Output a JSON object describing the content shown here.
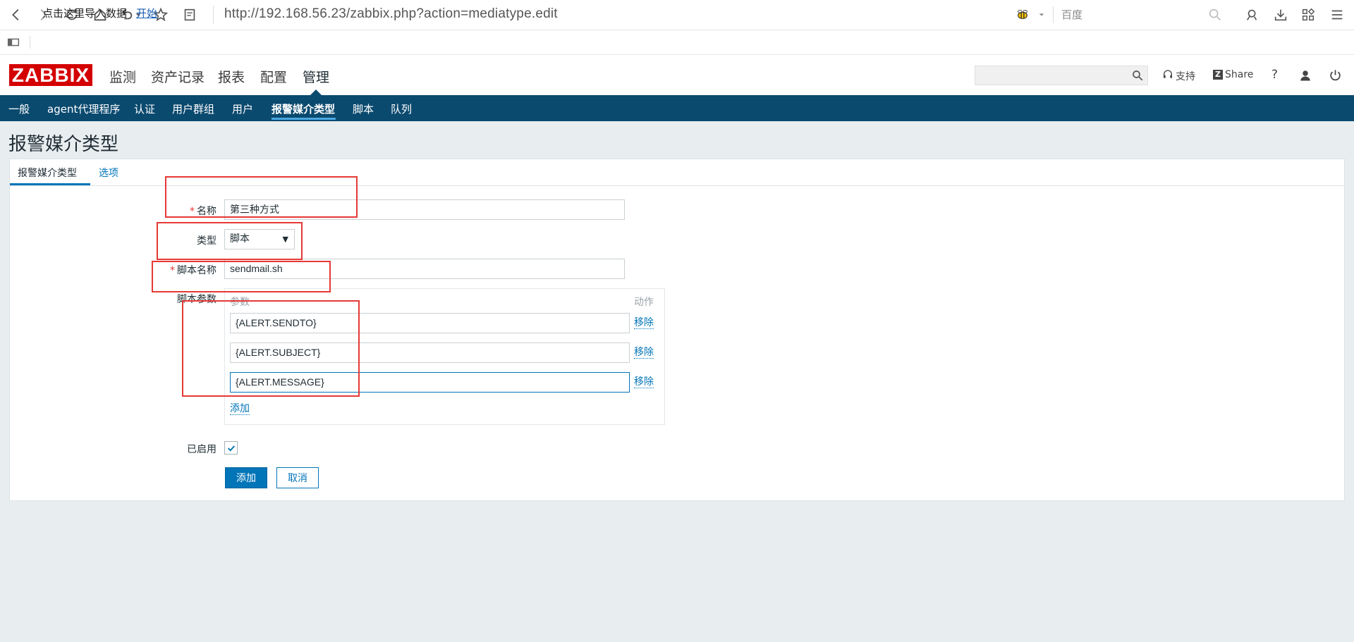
{
  "browser": {
    "url": "http://192.168.56.23/zabbix.php?action=mediatype.edit",
    "search_placeholder": "百度",
    "bookmark_text": "点击这里导入数据",
    "bookmark_link": "开始"
  },
  "header": {
    "logo": "ZABBIX",
    "menu": [
      "监测",
      "资产记录",
      "报表",
      "配置",
      "管理"
    ],
    "active_menu": "管理",
    "support_label": "支持",
    "share_label": "Share",
    "help_label": "?"
  },
  "subnav": {
    "items": [
      "一般",
      "agent代理程序",
      "认证",
      "用户群组",
      "用户",
      "报警媒介类型",
      "脚本",
      "队列"
    ],
    "active": "报警媒介类型"
  },
  "page": {
    "title": "报警媒介类型"
  },
  "tabs": {
    "media_type": "报警媒介类型",
    "options": "选项"
  },
  "form": {
    "name_label": "名称",
    "name_value": "第三种方式",
    "type_label": "类型",
    "type_value": "脚本",
    "script_name_label": "脚本名称",
    "script_name_value": "sendmail.sh",
    "script_params_label": "脚本参数",
    "params_col_header": "参数",
    "action_col_header": "动作",
    "params": [
      "{ALERT.SENDTO}",
      "{ALERT.SUBJECT}",
      "{ALERT.MESSAGE}"
    ],
    "remove_label": "移除",
    "add_param_label": "添加",
    "enabled_label": "已启用",
    "enabled": true,
    "add_button": "添加",
    "cancel_button": "取消"
  },
  "colors": {
    "zabbix_red": "#d40000",
    "subnav_bg": "#0b4a6f",
    "link_blue": "#0275b8",
    "annotation_red": "#e53935"
  }
}
